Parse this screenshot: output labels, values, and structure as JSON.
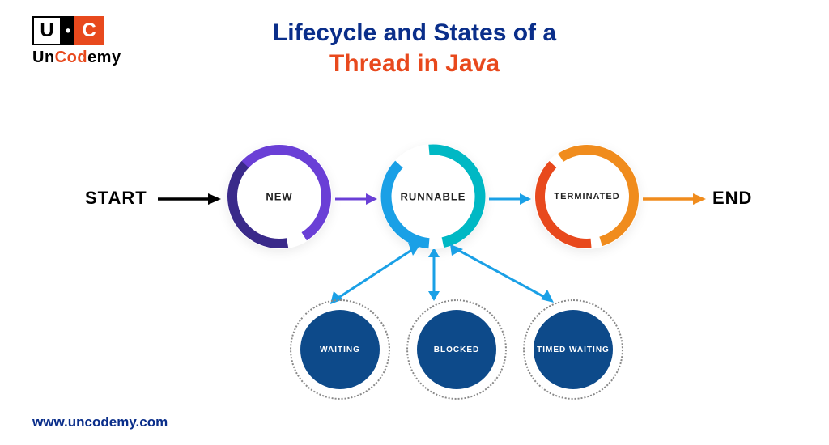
{
  "logo": {
    "letter_u": "U",
    "dot": "•",
    "letter_c": "C",
    "text_un": "Un",
    "text_cod": "Cod",
    "text_emy": "emy"
  },
  "title": {
    "line1": "Lifecycle and States of a",
    "line2": "Thread in Java"
  },
  "labels": {
    "start": "START",
    "end": "END"
  },
  "states": {
    "new": "NEW",
    "runnable": "RUNNABLE",
    "terminated": "TERMINATED",
    "waiting": "WAITING",
    "blocked": "BLOCKED",
    "timed_waiting": "TIMED WAITING"
  },
  "colors": {
    "purple": "#6a3fd6",
    "blue": "#1aa0e6",
    "cyan": "#00b8c4",
    "orange": "#f08c1d",
    "solid": "#0d4a8a",
    "title_blue": "#0a2e8a",
    "title_orange": "#e8491d"
  },
  "website": "www.uncodemy.com"
}
